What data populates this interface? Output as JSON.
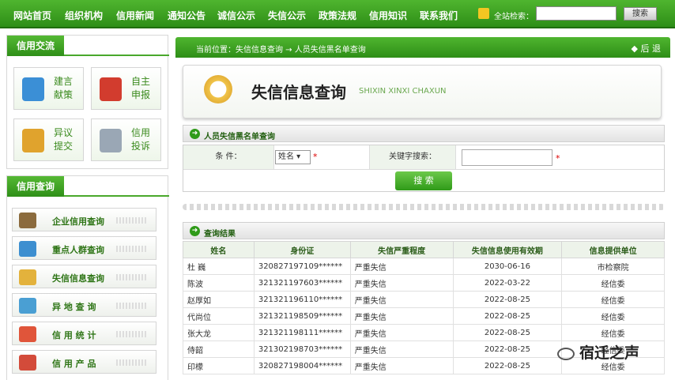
{
  "topnav": {
    "items": [
      "网站首页",
      "组织机构",
      "信用新闻",
      "通知公告",
      "诚信公示",
      "失信公示",
      "政策法规",
      "信用知识",
      "联系我们"
    ],
    "search_label": "全站检索：",
    "search_button": "搜索"
  },
  "sidebar": {
    "exchange_title": "信用交流",
    "tiles": [
      {
        "label": "建言献策",
        "icon": "lightbulb-icon",
        "color": "#3b8fd6"
      },
      {
        "label": "自主申报",
        "icon": "book-icon",
        "color": "#d23c2e"
      },
      {
        "label": "异议提交",
        "icon": "notebook-icon",
        "color": "#e0a32d"
      },
      {
        "label": "信用投诉",
        "icon": "document-pen-icon",
        "color": "#9aa7b5"
      }
    ],
    "query_title": "信用查询",
    "query_items": [
      {
        "label": "企业信用查询",
        "icon": "open-book-icon",
        "color": "#8b6b3d"
      },
      {
        "label": "重点人群查询",
        "icon": "users-icon",
        "color": "#3d8fd0"
      },
      {
        "label": "失信信息查询",
        "icon": "clock-icon",
        "color": "#e3b23c"
      },
      {
        "label": "异 地 查 询",
        "icon": "map-pin-icon",
        "color": "#4a9fd3"
      },
      {
        "label": "信 用 统 计",
        "icon": "pie-chart-icon",
        "color": "#e0553a"
      },
      {
        "label": "信 用 产 品",
        "icon": "product-icon",
        "color": "#d34b3a"
      }
    ]
  },
  "breadcrumb": {
    "text": "当前位置：失信信息查询 → 人员失信黑名单查询",
    "back": "◆ 后 退"
  },
  "header": {
    "title": "失信信息查询",
    "pinyin": "SHIXIN XINXI CHAXUN"
  },
  "query_section": {
    "title": "人员失信黑名单查询",
    "condition_label": "条    件：",
    "condition_value": "姓名 ▾",
    "keyword_label": "关键字搜索：",
    "submit": "搜  索"
  },
  "results": {
    "title": "查询结果",
    "headers": [
      "姓名",
      "身份证",
      "失信严重程度",
      "失信信息使用有效期",
      "信息提供单位"
    ],
    "rows": [
      [
        "杜  巍",
        "320827197109******",
        "严重失信",
        "2030-06-16",
        "市检察院"
      ],
      [
        "陈波",
        "321321197603******",
        "严重失信",
        "2022-03-22",
        "经信委"
      ],
      [
        "赵厚如",
        "321321196110******",
        "严重失信",
        "2022-08-25",
        "经信委"
      ],
      [
        "代尚位",
        "321321198509******",
        "严重失信",
        "2022-08-25",
        "经信委"
      ],
      [
        "张大龙",
        "321321198111******",
        "严重失信",
        "2022-08-25",
        "经信委"
      ],
      [
        "侍韶",
        "321302198703******",
        "严重失信",
        "2022-08-25",
        "经信委"
      ],
      [
        "印檬",
        "320827198004******",
        "严重失信",
        "2022-08-25",
        "经信委"
      ]
    ]
  },
  "watermark": "宿迁之声"
}
